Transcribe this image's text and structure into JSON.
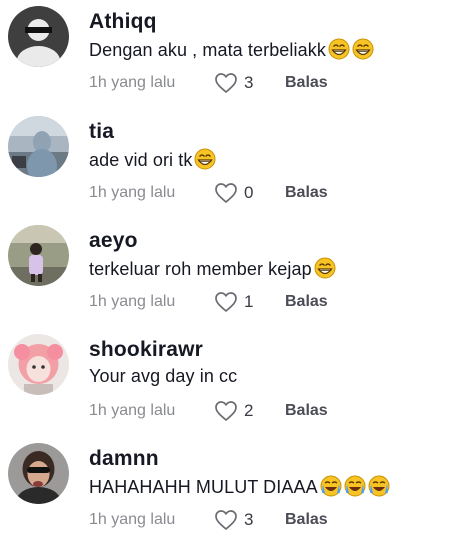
{
  "comments": [
    {
      "username": "Athiqq",
      "text": "Dengan aku , mata terbeliakk",
      "emojis": [
        "grin-sweat-emoji",
        "grin-sweat-emoji"
      ],
      "time": "1h yang lalu",
      "likes": "3",
      "reply_label": "Balas"
    },
    {
      "username": "tia",
      "text": "ade vid ori tk",
      "emojis": [
        "grin-sweat-emoji"
      ],
      "time": "1h yang lalu",
      "likes": "0",
      "reply_label": "Balas"
    },
    {
      "username": "aeyo",
      "text": "terkeluar roh member kejap",
      "emojis": [
        "grin-sweat-emoji"
      ],
      "time": "1h yang lalu",
      "likes": "1",
      "reply_label": "Balas"
    },
    {
      "username": "shookirawr",
      "text": "Your avg day in cc",
      "emojis": [],
      "time": "1h yang lalu",
      "likes": "2",
      "reply_label": "Balas"
    },
    {
      "username": "damnn",
      "text": "HAHAHAHH MULUT DIAAA",
      "emojis": [
        "crying-emoji",
        "crying-emoji",
        "crying-emoji"
      ],
      "time": "1h yang lalu",
      "likes": "3",
      "reply_label": "Balas"
    }
  ],
  "colors": {
    "username": "#161823",
    "meta": "#8a8b91",
    "emoji_face": "#f7c325"
  }
}
